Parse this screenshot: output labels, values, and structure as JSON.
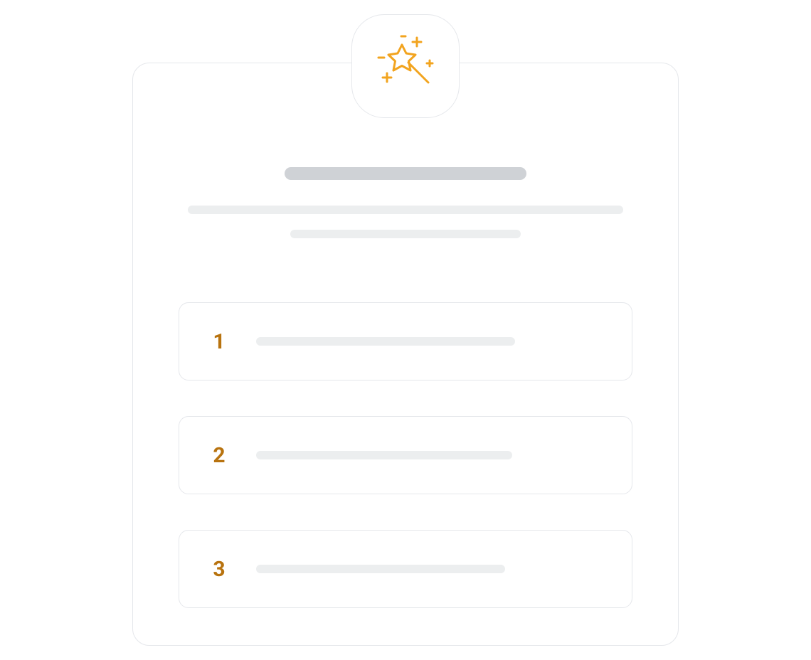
{
  "colors": {
    "accent": "#f2a41f",
    "number": "#b8730f",
    "skeletonDark": "#cfd2d6",
    "skeletonLight": "#eceeef",
    "border": "#e5e7eb"
  },
  "icon": "magic-wand-icon",
  "steps": [
    {
      "number": "1"
    },
    {
      "number": "2"
    },
    {
      "number": "3"
    }
  ]
}
